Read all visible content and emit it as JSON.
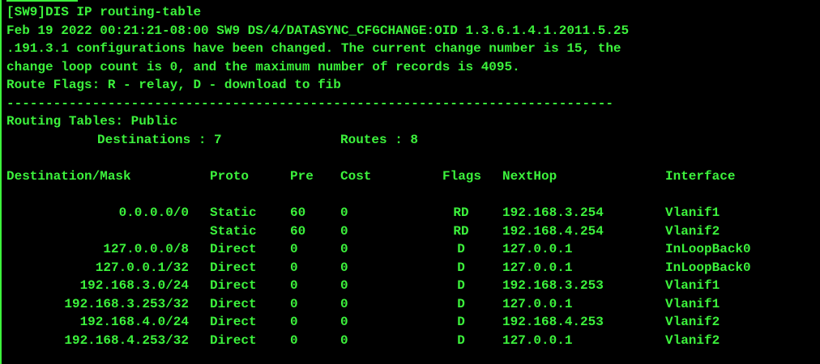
{
  "theme": {
    "background": "#000000",
    "text_color": "#3cf23c"
  },
  "terminal": {
    "command_line": "[SW9]DIS IP routing-table",
    "log_line_1": "Feb 19 2022 00:21:21-08:00 SW9 DS/4/DATASYNC_CFGCHANGE:OID 1.3.6.1.4.1.2011.5.25",
    "log_line_2": ".191.3.1 configurations have been changed. The current change number is 15, the",
    "log_line_3": "change loop count is 0, and the maximum number of records is 4095.",
    "route_flags": "Route Flags: R - relay, D - download to fib",
    "separator": "------------------------------------------------------------------------------",
    "routing_tables": "Routing Tables: Public",
    "destinations_label": "Destinations : 7",
    "routes_label": "Routes : 8"
  },
  "table": {
    "headers": {
      "destination_mask": "Destination/Mask",
      "proto": "Proto",
      "pre": "Pre",
      "cost": "Cost",
      "flags": "Flags",
      "nexthop": "NextHop",
      "interface": "Interface"
    },
    "rows": [
      {
        "destination": "0.0.0.0/0",
        "proto": "Static",
        "pre": "60",
        "cost": "0",
        "flags": "RD",
        "nexthop": "192.168.3.254",
        "interface": "Vlanif1"
      },
      {
        "destination": "",
        "proto": "Static",
        "pre": "60",
        "cost": "0",
        "flags": "RD",
        "nexthop": "192.168.4.254",
        "interface": "Vlanif2"
      },
      {
        "destination": "127.0.0.0/8",
        "proto": "Direct",
        "pre": "0",
        "cost": "0",
        "flags": "D",
        "nexthop": "127.0.0.1",
        "interface": "InLoopBack0"
      },
      {
        "destination": "127.0.0.1/32",
        "proto": "Direct",
        "pre": "0",
        "cost": "0",
        "flags": "D",
        "nexthop": "127.0.0.1",
        "interface": "InLoopBack0"
      },
      {
        "destination": "192.168.3.0/24",
        "proto": "Direct",
        "pre": "0",
        "cost": "0",
        "flags": "D",
        "nexthop": "192.168.3.253",
        "interface": "Vlanif1"
      },
      {
        "destination": "192.168.3.253/32",
        "proto": "Direct",
        "pre": "0",
        "cost": "0",
        "flags": "D",
        "nexthop": "127.0.0.1",
        "interface": "Vlanif1"
      },
      {
        "destination": "192.168.4.0/24",
        "proto": "Direct",
        "pre": "0",
        "cost": "0",
        "flags": "D",
        "nexthop": "192.168.4.253",
        "interface": "Vlanif2"
      },
      {
        "destination": "192.168.4.253/32",
        "proto": "Direct",
        "pre": "0",
        "cost": "0",
        "flags": "D",
        "nexthop": "127.0.0.1",
        "interface": "Vlanif2"
      }
    ]
  }
}
